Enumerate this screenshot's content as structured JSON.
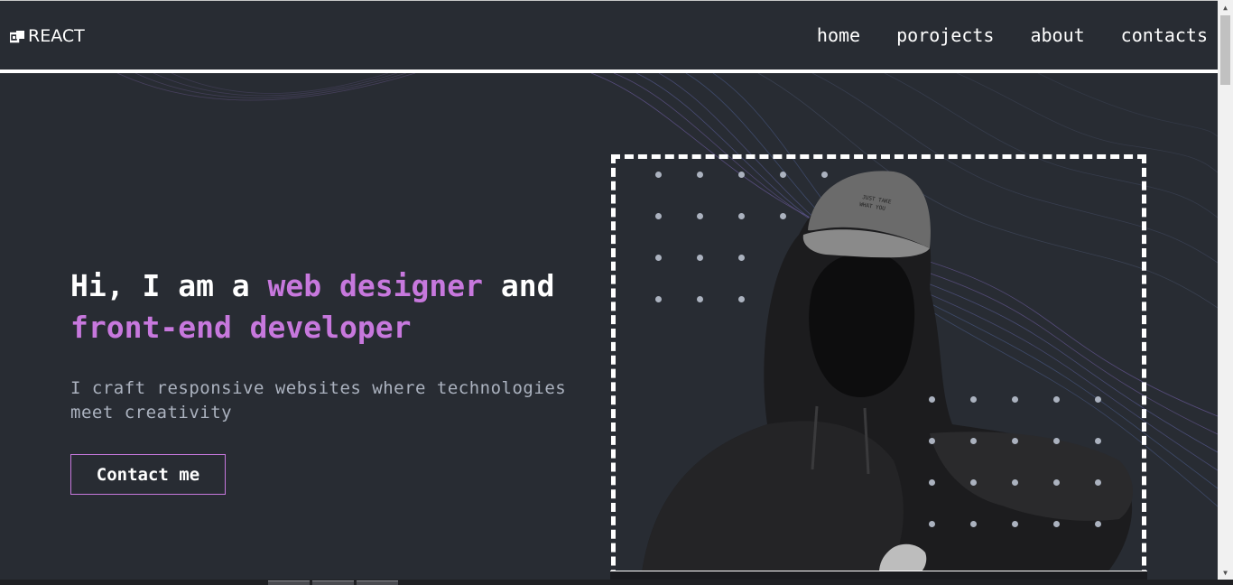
{
  "header": {
    "logo_text": "REACT",
    "nav": [
      {
        "label": "home"
      },
      {
        "label": "porojects"
      },
      {
        "label": "about"
      },
      {
        "label": "contacts"
      }
    ]
  },
  "hero": {
    "title_part1": "Hi, I am a ",
    "title_accent1": "web designer",
    "title_part2": " and",
    "title_accent2": "front-end developer",
    "subtitle": "I craft responsive websites where technologies meet creativity",
    "cta_label": "Contact me"
  },
  "colors": {
    "background": "#282c33",
    "accent": "#c778dd",
    "text": "#ffffff",
    "muted": "#abb2bf"
  },
  "icons": {
    "logo": "logo-icon",
    "scroll_up": "scroll-up-arrow-icon",
    "scroll_down": "scroll-down-arrow-icon"
  }
}
